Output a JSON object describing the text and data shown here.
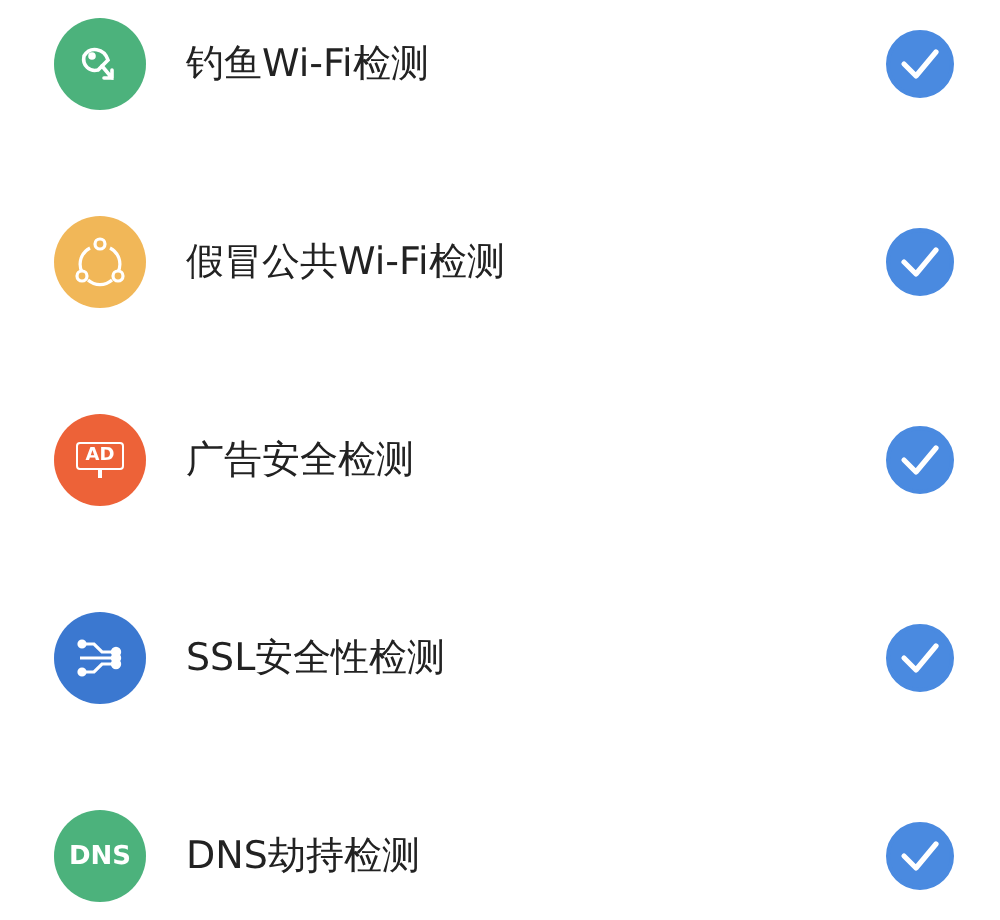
{
  "items": [
    {
      "kind": "fish",
      "color": "#4cb27c",
      "label": "钓鱼Wi-Fi检测",
      "checked": true
    },
    {
      "kind": "share",
      "color": "#f1b758",
      "label": "假冒公共Wi-Fi检测",
      "checked": true
    },
    {
      "kind": "ad",
      "color": "#ed6238",
      "icon_text": "AD",
      "label": "广告安全检测",
      "checked": true
    },
    {
      "kind": "circuit",
      "color": "#3b78d0",
      "label": "SSL安全性检测",
      "checked": true
    },
    {
      "kind": "dns",
      "color": "#4cb27c",
      "icon_text": "DNS",
      "label": "DNS劫持检测",
      "checked": true
    }
  ]
}
